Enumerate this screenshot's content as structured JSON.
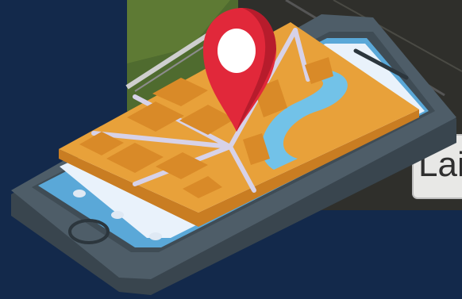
{
  "illustration": {
    "background_color": "#13294b",
    "photo": {
      "sign_text": "Lai"
    },
    "map_pin_icon": "map-pin-icon",
    "phone_icon": "smartphone-icon",
    "colors": {
      "phone_body": "#4e5d68",
      "phone_edge": "#39454e",
      "screen": "#5aa8d8",
      "map_surface": "#e8a13a",
      "map_edge": "#c97d22",
      "map_block": "#d98a28",
      "road": "#d7d2e8",
      "river": "#72c2e8",
      "pin": "#e1283a",
      "pin_shade": "#b71c2c",
      "pin_center": "#ffffff"
    }
  }
}
